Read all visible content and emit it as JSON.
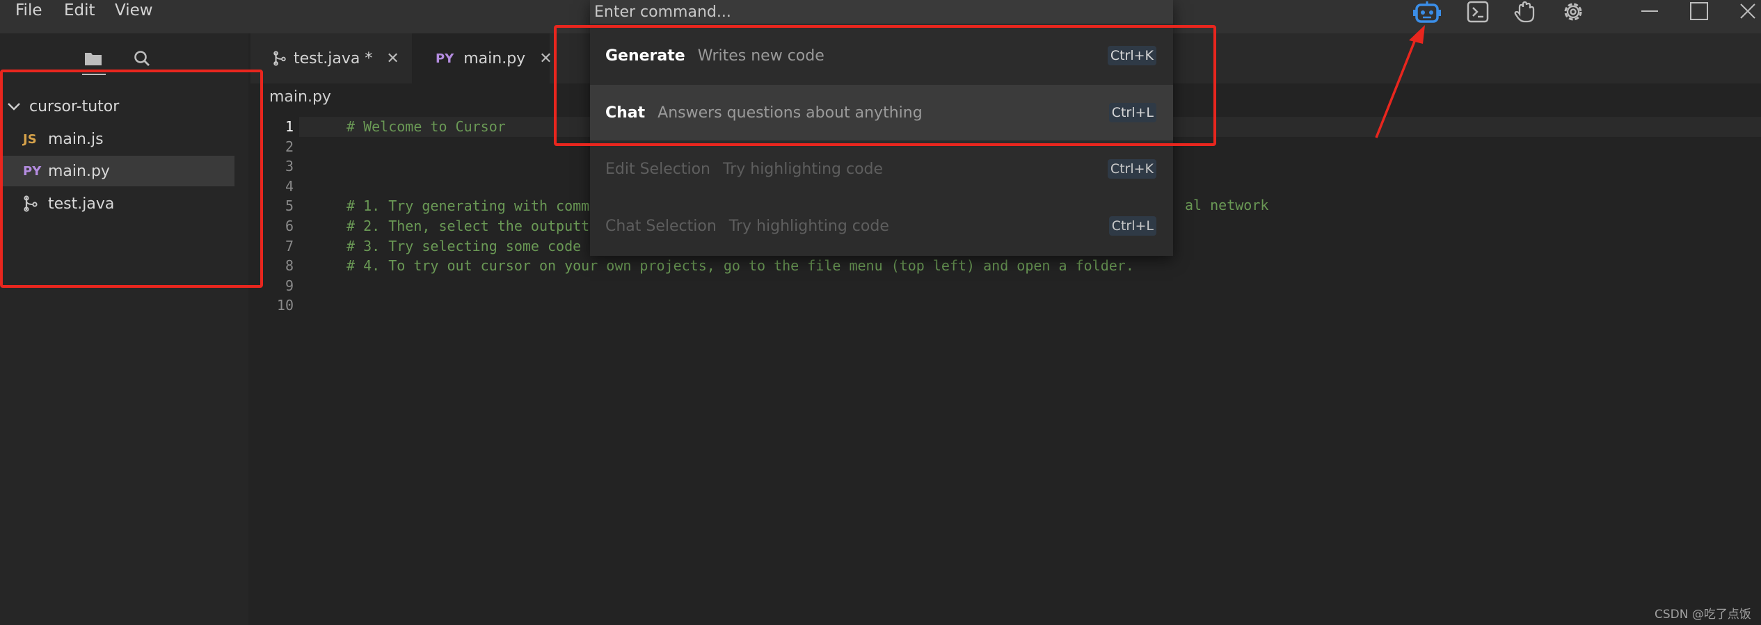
{
  "menu": {
    "file": "File",
    "edit": "Edit",
    "view": "View"
  },
  "colors": {
    "accent_blue": "#3b8ee8",
    "annotation_red": "#e8261e",
    "comment_green": "#6a9955",
    "js_badge": "#d6a24a",
    "py_badge": "#b48ce0",
    "java_icon": "#c8c8c8"
  },
  "toolbar_icons": [
    "robot-icon",
    "terminal-icon",
    "hand-icon",
    "gear-icon"
  ],
  "sidebar": {
    "folder": "cursor-tutor",
    "files": [
      {
        "badge": "JS",
        "name": "main.js"
      },
      {
        "badge": "PY",
        "name": "main.py"
      },
      {
        "badge": "",
        "name": "test.java"
      }
    ]
  },
  "tabs": [
    {
      "label": "test.java *",
      "badge": ""
    },
    {
      "label": "main.py",
      "badge": "PY"
    }
  ],
  "editor": {
    "breadcrumb": "main.py",
    "current_line": 1,
    "line_numbers": [
      "1",
      "2",
      "3",
      "4",
      "5",
      "6",
      "7",
      "8",
      "9",
      "10"
    ],
    "lines": [
      "# Welcome to Cursor",
      "",
      "",
      "",
      "# 1. Try generating with comm",
      "# 2. Then, select the outputt",
      "# 3. Try selecting some code",
      "# 4. To try out cursor on your own projects, go to the file menu (top left) and open a folder.",
      "",
      ""
    ],
    "overflow_fragment": "al network"
  },
  "palette": {
    "placeholder": "Enter command...",
    "commands": [
      {
        "title": "Generate",
        "desc": "Writes new code",
        "key": "Ctrl+K"
      },
      {
        "title": "Chat",
        "desc": "Answers questions about anything",
        "key": "Ctrl+L"
      },
      {
        "title": "Edit Selection",
        "desc": "Try highlighting code",
        "key": "Ctrl+K"
      },
      {
        "title": "Chat Selection",
        "desc": "Try highlighting code",
        "key": "Ctrl+L"
      }
    ]
  },
  "watermark": "CSDN @吃了点饭"
}
